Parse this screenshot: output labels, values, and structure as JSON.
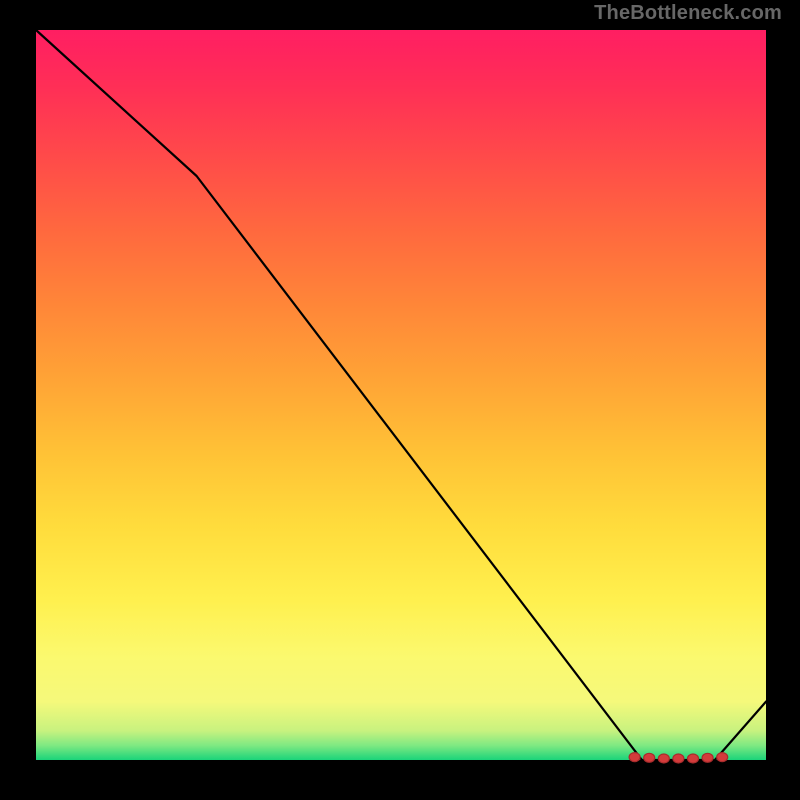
{
  "attribution": "TheBottleneck.com",
  "chart_data": {
    "type": "line",
    "title": "",
    "xlabel": "",
    "ylabel": "",
    "xlim": [
      0,
      100
    ],
    "ylim": [
      0,
      100
    ],
    "series": [
      {
        "name": "curve",
        "x": [
          0,
          22,
          83,
          93,
          100
        ],
        "values": [
          100,
          80,
          0,
          0,
          8
        ]
      }
    ],
    "markers": {
      "name": "minimum-band",
      "x": [
        82,
        84,
        86,
        88,
        90,
        92,
        94
      ],
      "values": [
        0.4,
        0.3,
        0.2,
        0.2,
        0.2,
        0.3,
        0.4
      ]
    }
  }
}
